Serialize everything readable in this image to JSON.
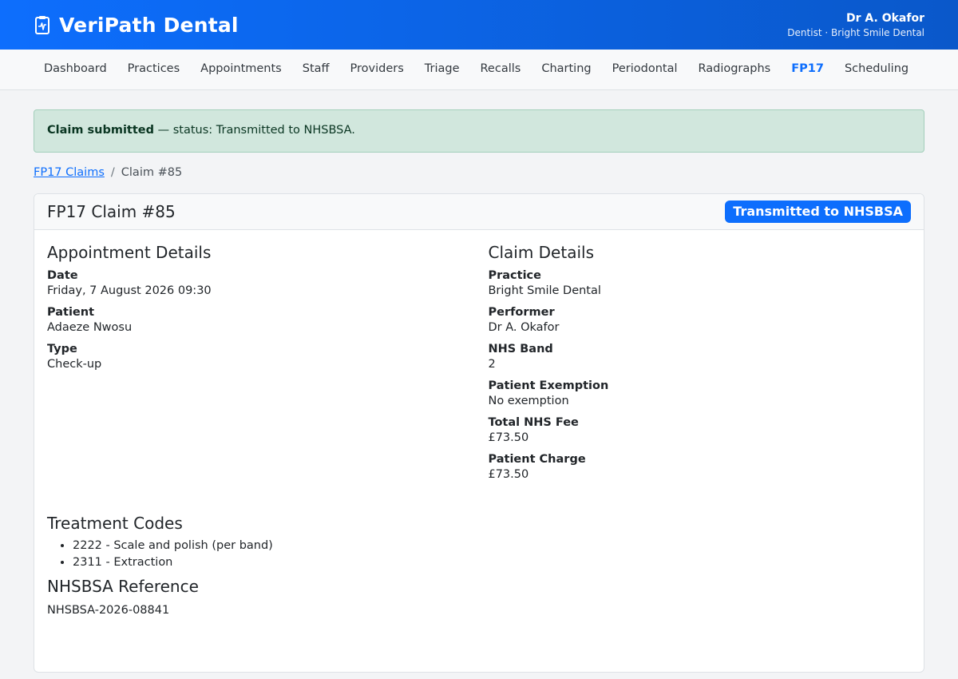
{
  "app": {
    "brand": "VeriPath Dental",
    "user_name": "Dr A. Okafor",
    "user_role": "Dentist · Bright Smile Dental"
  },
  "nav": {
    "items": [
      {
        "label": "Dashboard"
      },
      {
        "label": "Practices"
      },
      {
        "label": "Appointments"
      },
      {
        "label": "Staff"
      },
      {
        "label": "Providers"
      },
      {
        "label": "Triage"
      },
      {
        "label": "Recalls"
      },
      {
        "label": "Charting"
      },
      {
        "label": "Periodontal"
      },
      {
        "label": "Radiographs"
      },
      {
        "label": "FP17"
      },
      {
        "label": "Scheduling"
      }
    ],
    "active": "FP17"
  },
  "alert": {
    "bold": "Claim submitted",
    "text": " — status: Transmitted to NHSBSA."
  },
  "breadcrumb": {
    "link": "FP17 Claims",
    "separator": "/",
    "current": "Claim #85"
  },
  "claim": {
    "title": "FP17 Claim #85",
    "status": "Transmitted to NHSBSA",
    "appointment": {
      "heading": "Appointment Details",
      "date_label": "Date",
      "date": "Friday, 7 August 2026 09:30",
      "patient_label": "Patient",
      "patient": "Adaeze Nwosu",
      "type_label": "Type",
      "type": "Check-up"
    },
    "details": {
      "heading": "Claim Details",
      "practice_label": "Practice",
      "practice": "Bright Smile Dental",
      "performer_label": "Performer",
      "performer": "Dr A. Okafor",
      "band_label": "NHS Band",
      "band": "2",
      "exemption_label": "Patient Exemption",
      "exemption": "No exemption",
      "fee_label": "Total NHS Fee",
      "fee": "£73.50",
      "charge_label": "Patient Charge",
      "charge": "£73.50"
    },
    "treatment": {
      "heading": "Treatment Codes",
      "codes": [
        "2222 - Scale and polish (per band)",
        "2311 - Extraction"
      ]
    },
    "reference": {
      "heading": "NHSBSA Reference",
      "value": "NHSBSA-2026-08841"
    }
  },
  "colors": {
    "primary": "#0d6efd",
    "alert_bg": "#d1e7dd",
    "alert_text": "#0a3622"
  }
}
